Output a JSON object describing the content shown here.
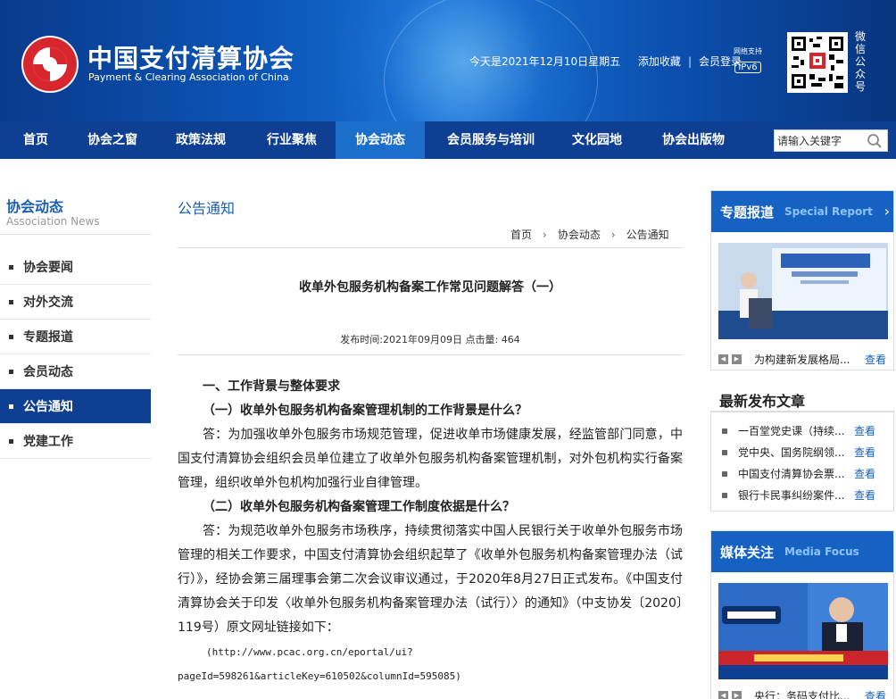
{
  "header": {
    "org_name_cn": "中国支付清算协会",
    "org_name_en": "Payment & Clearing Association of China",
    "date_text": "今天是2021年12月10日星期五",
    "add_favorite": "添加收藏",
    "member_login": "会员登录",
    "ipv6_top": "网络支持",
    "ipv6_badge": "IPv6",
    "wechat_label": "微信公众号"
  },
  "nav": {
    "items": [
      {
        "label": "首页"
      },
      {
        "label": "协会之窗"
      },
      {
        "label": "政策法规"
      },
      {
        "label": "行业聚焦"
      },
      {
        "label": "协会动态"
      },
      {
        "label": "会员服务与培训"
      },
      {
        "label": "文化园地"
      },
      {
        "label": "协会出版物"
      }
    ],
    "search_placeholder": "请输入关键字"
  },
  "sidebar": {
    "title": "协会动态",
    "subtitle": "Association News",
    "items": [
      {
        "label": "协会要闻"
      },
      {
        "label": "对外交流"
      },
      {
        "label": "专题报道"
      },
      {
        "label": "会员动态"
      },
      {
        "label": "公告通知"
      },
      {
        "label": "党建工作"
      }
    ]
  },
  "main": {
    "section_title": "公告通知",
    "breadcrumb": [
      "首页",
      "协会动态",
      "公告通知"
    ],
    "article_title": "收单外包服务机构备案工作常见问题解答（一）",
    "meta": "发布时间:2021年09月09日 点击量: 464",
    "heading1": "一、工作背景与整体要求",
    "q1": "（一）收单外包服务机构备案管理机制的工作背景是什么？",
    "a1": "答：为加强收单外包服务市场规范管理，促进收单市场健康发展，经监管部门同意，中国支付清算协会组织会员单位建立了收单外包服务机构备案管理机制，对外包机构实行备案管理，组织收单外包机构加强行业自律管理。",
    "q2": "（二）收单外包服务机构备案管理工作制度依据是什么？",
    "a2": "答：为规范收单外包服务市场秩序，持续贯彻落实中国人民银行关于收单外包服务市场管理的相关工作要求，中国支付清算协会组织起草了《收单外包服务机构备案管理办法（试行）》，经协会第三届理事会第二次会议审议通过，于2020年8月27日正式发布。《中国支付清算协会关于印发〈收单外包服务机构备案管理办法（试行）〉的通知》（中支协发〔2020〕119号）原文网址链接如下：",
    "url_line1": "(http://www.pcac.org.cn/eportal/ui?",
    "url_line2": "pageId=598261&articleKey=610502&columnId=595085)"
  },
  "right": {
    "special": {
      "title_cn": "专题报道",
      "title_en": "Special Report",
      "caption": "为构建新发展格局...",
      "more": "查看"
    },
    "latest": {
      "title": "最新发布文章",
      "items": [
        {
          "text": "一百堂党史课（持续...",
          "more": "查看"
        },
        {
          "text": "党中央、国务院纲领...",
          "more": "查看"
        },
        {
          "text": "中国支付清算协会票...",
          "more": "查看"
        },
        {
          "text": "银行卡民事纠纷案件...",
          "more": "查看"
        }
      ]
    },
    "media": {
      "title_cn": "媒体关注",
      "title_en": "Media Focus",
      "caption": "央行：务码支付比...",
      "more": "查看"
    }
  }
}
